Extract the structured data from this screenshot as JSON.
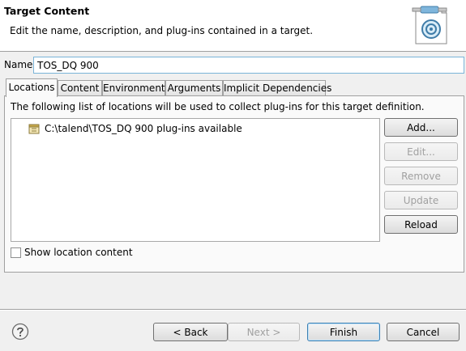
{
  "header": {
    "title": "Target Content",
    "description": "Edit the name, description, and plug-ins contained in a target."
  },
  "name": {
    "label": "Name:",
    "value": "TOS_DQ 900"
  },
  "tabs": [
    {
      "label": "Locations",
      "active": true
    },
    {
      "label": "Content"
    },
    {
      "label": "Environment"
    },
    {
      "label": "Arguments"
    },
    {
      "label": "Implicit Dependencies"
    }
  ],
  "locations": {
    "description": "The following list of locations will be used to collect plug-ins for this target definition.",
    "items": [
      {
        "label": "C:\\talend\\TOS_DQ 900 plug-ins available",
        "icon": "plugin-location-icon"
      }
    ],
    "buttons": {
      "add": "Add...",
      "edit": "Edit...",
      "remove": "Remove",
      "update": "Update",
      "reload": "Reload"
    },
    "show_content_label": "Show location content",
    "show_content_checked": false
  },
  "footer": {
    "back": "< Back",
    "next": "Next >",
    "finish": "Finish",
    "cancel": "Cancel"
  },
  "colors": {
    "accent": "#3c7fb1",
    "disabled_text": "#a0a0a0",
    "header_bg": "#ffffff",
    "dialog_bg": "#f0f0f0"
  }
}
